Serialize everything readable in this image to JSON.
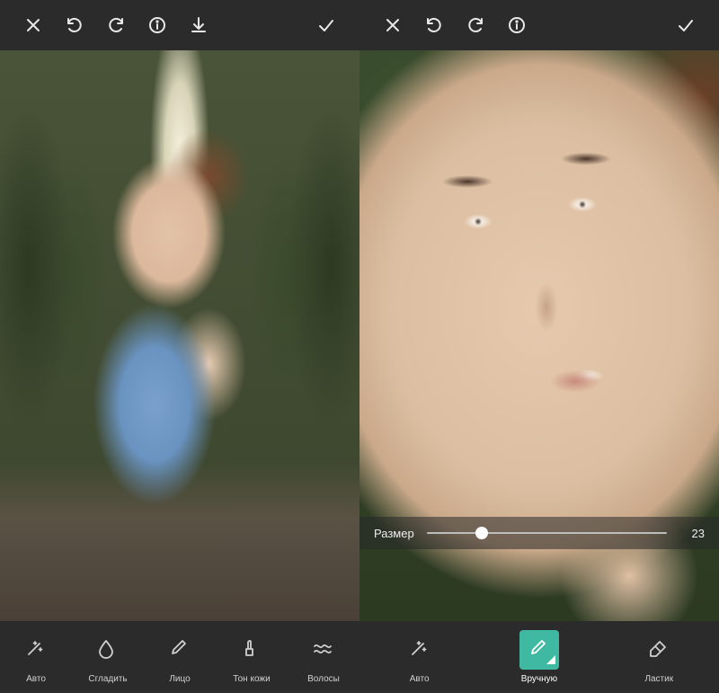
{
  "colors": {
    "accent": "#3fb9a1",
    "toolbar_bg": "#2b2b2b"
  },
  "left": {
    "toolbar": {
      "close": "close-icon",
      "undo": "undo-icon",
      "redo": "redo-icon",
      "info": "info-icon",
      "download": "download-icon",
      "confirm": "check-icon"
    },
    "tools": [
      {
        "id": "auto",
        "label": "Авто",
        "icon": "sparkle-wand-icon"
      },
      {
        "id": "smooth",
        "label": "Сгладить",
        "icon": "drop-icon"
      },
      {
        "id": "face",
        "label": "Лицо",
        "icon": "brush-icon"
      },
      {
        "id": "skintone",
        "label": "Тон кожи",
        "icon": "lipstick-icon"
      },
      {
        "id": "hair",
        "label": "Волосы",
        "icon": "wave-icon"
      }
    ]
  },
  "right": {
    "toolbar": {
      "close": "close-icon",
      "undo": "undo-icon",
      "redo": "redo-icon",
      "info": "info-icon",
      "confirm": "check-icon"
    },
    "slider": {
      "label": "Размер",
      "value": 23,
      "min": 0,
      "max": 100
    },
    "tools": [
      {
        "id": "auto",
        "label": "Авто",
        "icon": "sparkle-wand-icon",
        "active": false
      },
      {
        "id": "manual",
        "label": "Вручную",
        "icon": "brush-icon",
        "active": true
      },
      {
        "id": "eraser",
        "label": "Ластик",
        "icon": "eraser-icon",
        "active": false
      }
    ]
  }
}
